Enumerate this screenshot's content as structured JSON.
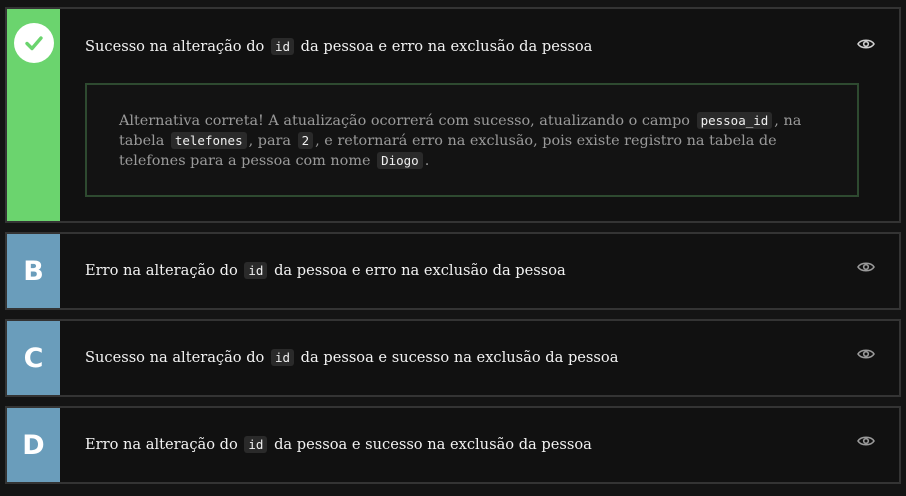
{
  "options": [
    {
      "letter": "",
      "text_before": "Sucesso na alteração do",
      "code": "id",
      "text_after": "da pessoa e erro na exclusão da pessoa",
      "correct": true,
      "feedback": {
        "t1": "Alternativa correta! A atualização ocorrerá com sucesso, atualizando o campo",
        "c1": "pessoa_id",
        "t2": ", na tabela",
        "c2": "telefones",
        "t3": ", para",
        "c3": "2",
        "t4": ", e retornará erro na exclusão, pois existe registro na tabela de telefones para a pessoa com nome",
        "c4": "Diogo",
        "t5": "."
      }
    },
    {
      "letter": "B",
      "text_before": "Erro na alteração do",
      "code": "id",
      "text_after": "da pessoa e erro na exclusão da pessoa"
    },
    {
      "letter": "C",
      "text_before": "Sucesso na alteração do",
      "code": "id",
      "text_after": "da pessoa e sucesso na exclusão da pessoa"
    },
    {
      "letter": "D",
      "text_before": "Erro na alteração do",
      "code": "id",
      "text_after": "da pessoa e sucesso na exclusão da pessoa"
    }
  ],
  "colors": {
    "correct": "#6bd46e",
    "letter_bg": "#6a9dbb",
    "card_bg": "#111111",
    "card_border": "#343434",
    "feedback_border": "#2e4a30"
  },
  "icons": {
    "correct": "check-icon",
    "reveal": "eye-icon"
  }
}
